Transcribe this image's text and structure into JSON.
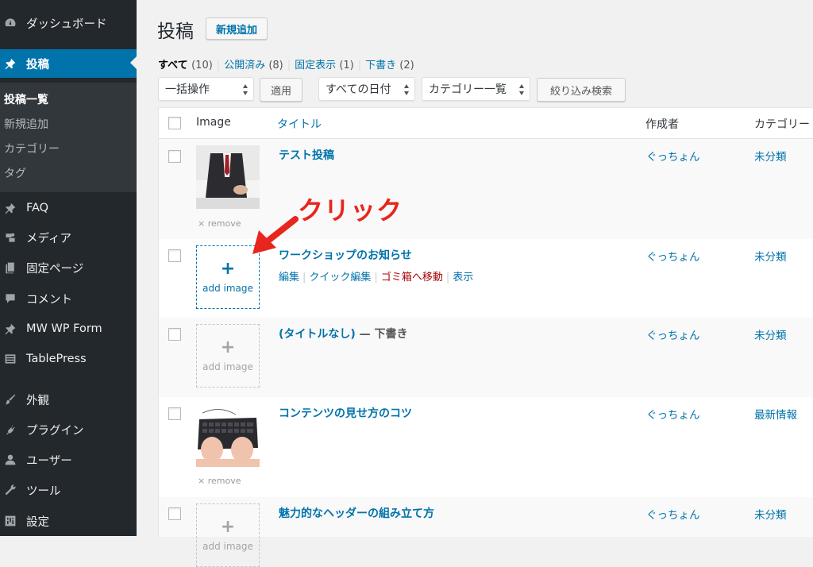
{
  "sidebar": {
    "items": [
      {
        "label": "ダッシュボード",
        "icon": "dashboard-icon"
      },
      {
        "label": "投稿",
        "icon": "pin-icon",
        "active": true
      },
      {
        "label": "FAQ",
        "icon": "pin-icon"
      },
      {
        "label": "メディア",
        "icon": "media-icon"
      },
      {
        "label": "固定ページ",
        "icon": "page-icon"
      },
      {
        "label": "コメント",
        "icon": "comment-icon"
      },
      {
        "label": "MW WP Form",
        "icon": "pin-icon"
      },
      {
        "label": "TablePress",
        "icon": "table-icon"
      },
      {
        "label": "外観",
        "icon": "brush-icon"
      },
      {
        "label": "プラグイン",
        "icon": "plugin-icon"
      },
      {
        "label": "ユーザー",
        "icon": "user-icon"
      },
      {
        "label": "ツール",
        "icon": "wrench-icon"
      },
      {
        "label": "設定",
        "icon": "settings-icon"
      }
    ],
    "submenu": [
      "投稿一覧",
      "新規追加",
      "カテゴリー",
      "タグ"
    ]
  },
  "header": {
    "title": "投稿",
    "add_new": "新規追加"
  },
  "filters": {
    "all": "すべて",
    "all_count": "(10)",
    "published": "公開済み",
    "published_count": "(8)",
    "sticky": "固定表示",
    "sticky_count": "(1)",
    "draft": "下書き",
    "draft_count": "(2)",
    "sep": "|"
  },
  "toolbar": {
    "bulk": "一括操作",
    "apply": "適用",
    "dates": "すべての日付",
    "category": "カテゴリー一覧",
    "filter": "絞り込み検索"
  },
  "table": {
    "headers": {
      "image": "Image",
      "title": "タイトル",
      "author": "作成者",
      "category": "カテゴリー"
    },
    "remove_label": "× remove",
    "add_image_plus": "+",
    "add_image_label": "add image",
    "rows": [
      {
        "title": "テスト投稿",
        "author": "ぐっちょん",
        "category": "未分類"
      },
      {
        "title": "ワークショップのお知らせ",
        "author": "ぐっちょん",
        "category": "未分類",
        "actions": {
          "edit": "編集",
          "quick_edit": "クイック編集",
          "trash": "ゴミ箱へ移動",
          "view": "表示"
        }
      },
      {
        "title": "(タイトルなし)",
        "state": " — 下書き",
        "author": "ぐっちょん",
        "category": "未分類"
      },
      {
        "title": "コンテンツの見せ方のコツ",
        "author": "ぐっちょん",
        "category": "最新情報"
      },
      {
        "title": "魅力的なヘッダーの組み立て方",
        "author": "ぐっちょん",
        "category": "未分類"
      }
    ]
  },
  "annotation": {
    "text": "クリック",
    "color": "#e8261d"
  },
  "colors": {
    "accent": "#0073aa",
    "sidebar": "#23282d",
    "trash": "#a00"
  }
}
